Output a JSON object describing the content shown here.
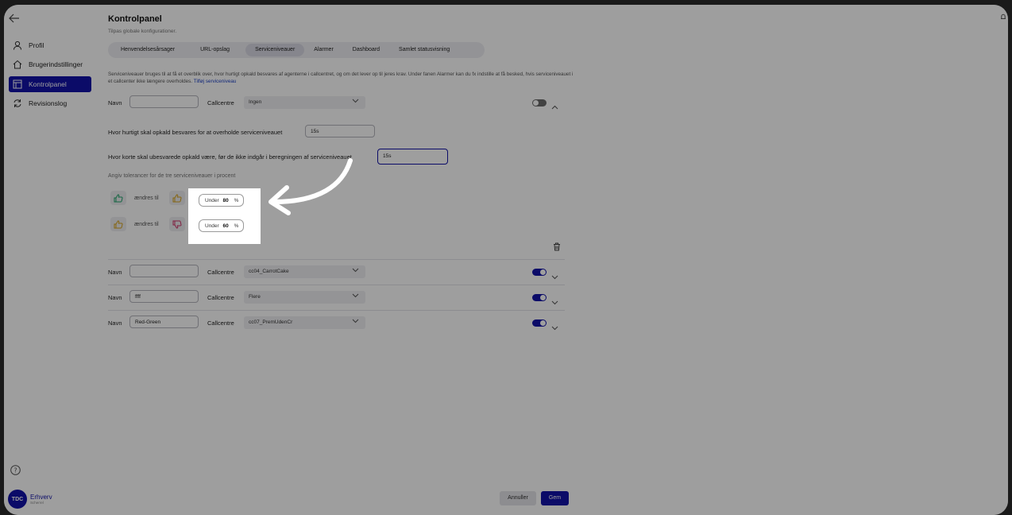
{
  "sidebar": {
    "items": [
      {
        "label": "Profil",
        "icon": "user-icon"
      },
      {
        "label": "Brugerindstillinger",
        "icon": "home-icon"
      },
      {
        "label": "Kontrolpanel",
        "icon": "panel-icon",
        "active": true
      },
      {
        "label": "Revisionslog",
        "icon": "refresh-icon"
      }
    ],
    "logo_text": "TDC",
    "brand": "Erhverv",
    "brand_sub": "Scherrel"
  },
  "header": {
    "title": "Kontrolpanel",
    "subtitle": "Tilpas globale konfigurationer."
  },
  "tabs": [
    {
      "label": "Henvendelsesårsager"
    },
    {
      "label": "URL-opslag"
    },
    {
      "label": "Serviceniveauer",
      "active": true
    },
    {
      "label": "Alarmer"
    },
    {
      "label": "Dashboard"
    },
    {
      "label": "Samlet statusvisning"
    }
  ],
  "description": {
    "text": "Serviceniveauer bruges til at få et overblik over, hvor hurtigt opkald besvares af agenterne i callcentret, og om det lever op til jeres krav. Under fanen Alarmer kan du fx indstille at få besked, hvis serviceniveauet i et callcenter ikke længere overholdes.",
    "link": "Tilføj serviceniveau"
  },
  "labels": {
    "name": "Navn",
    "callcentre": "Callcentre",
    "changes_to": "ændres til",
    "tolerance_heading": "Angiv tolerancer for de tre serviceniveauer i procent",
    "answer_question": "Hvor hurtigt skal opkald besvares for at overholde serviceniveauet",
    "short_question": "Hvor korte skal ubesvarede opkald være, før de ikke indgår i beregningen af serviceniveauet",
    "under": "Under",
    "percent": "%"
  },
  "expanded_level": {
    "name": "",
    "callcentre": "Ingen",
    "answer_time": "15s",
    "short_time": "15s",
    "tolerances": [
      {
        "value": "80"
      },
      {
        "value": "60"
      }
    ]
  },
  "levels": [
    {
      "name": "",
      "callcentre": "cc04_CarrotCake",
      "enabled": true
    },
    {
      "name": "ffff",
      "callcentre": "Flere",
      "enabled": true
    },
    {
      "name": "Red-Green",
      "callcentre": "cc07_PremUdenCr",
      "enabled": true
    }
  ],
  "footer": {
    "cancel": "Annuller",
    "save": "Gem"
  },
  "colors": {
    "accent": "#1212a8",
    "good": "#1fa36a",
    "warn": "#d8a31a",
    "bad": "#d0356a"
  }
}
